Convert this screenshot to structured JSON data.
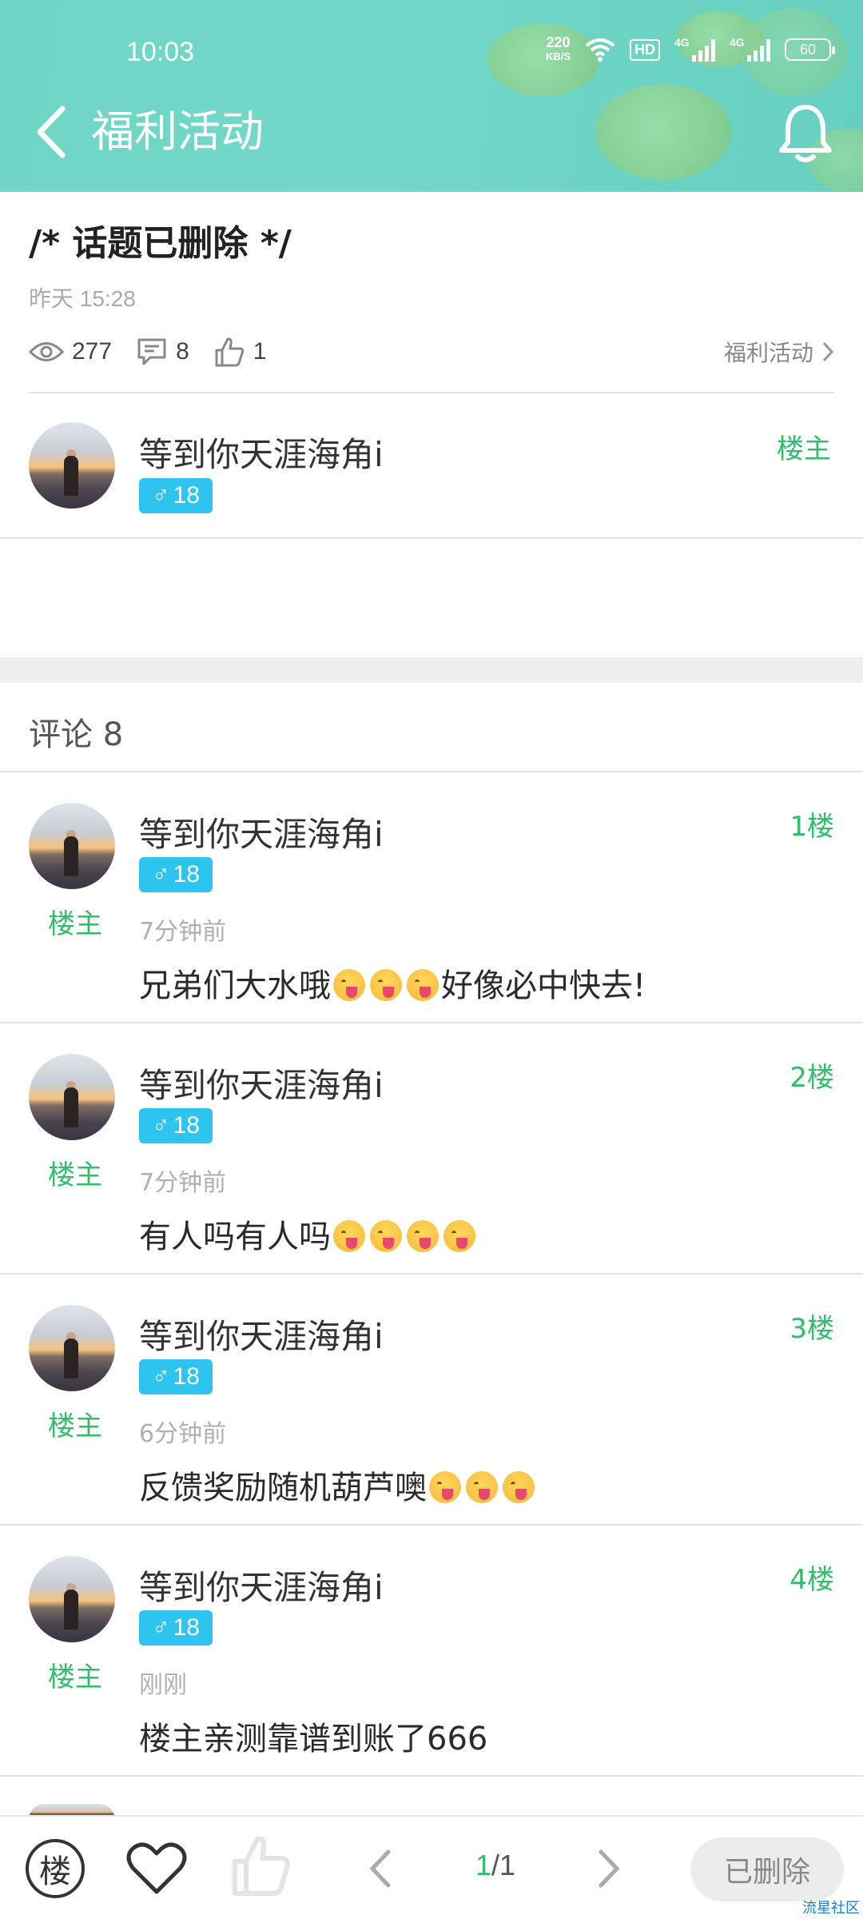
{
  "status_bar": {
    "time": "10:03",
    "net_speed_value": "220",
    "net_speed_unit": "KB/S",
    "hd_label": "HD",
    "signal_1": "4G",
    "signal_2": "4G",
    "battery": "60"
  },
  "header": {
    "title": "福利活动",
    "icons": [
      "back-arrow-icon",
      "bell-icon"
    ]
  },
  "topic": {
    "title": "/* 话题已删除 */",
    "time": "昨天 15:28",
    "views": "277",
    "comments": "8",
    "likes": "1",
    "category": "福利活动",
    "author": {
      "name": "等到你天涯海角i",
      "gender": "♂",
      "age": "18",
      "tag": "楼主"
    }
  },
  "comments_section": {
    "heading": "评论 8",
    "items": [
      {
        "name": "等到你天涯海角i",
        "gender": "♂",
        "age": "18",
        "owner_tag": "楼主",
        "floor": "1楼",
        "time": "7分钟前",
        "text_before": "兄弟们大水哦",
        "emoji_count": 3,
        "text_after": "好像必中快去!"
      },
      {
        "name": "等到你天涯海角i",
        "gender": "♂",
        "age": "18",
        "owner_tag": "楼主",
        "floor": "2楼",
        "time": "7分钟前",
        "text_before": "有人吗有人吗",
        "emoji_count": 4,
        "text_after": ""
      },
      {
        "name": "等到你天涯海角i",
        "gender": "♂",
        "age": "18",
        "owner_tag": "楼主",
        "floor": "3楼",
        "time": "6分钟前",
        "text_before": "反馈奖励随机葫芦噢",
        "emoji_count": 3,
        "text_after": ""
      },
      {
        "name": "等到你天涯海角i",
        "gender": "♂",
        "age": "18",
        "owner_tag": "楼主",
        "floor": "4楼",
        "time": "刚刚",
        "text_before": "楼主亲测靠谱到账了666",
        "emoji_count": 0,
        "text_after": ""
      }
    ]
  },
  "bottom_bar": {
    "floor_button": "楼",
    "page_current": "1",
    "page_total": "/1",
    "deleted_label": "已删除",
    "watermark": "流星社区"
  },
  "colors": {
    "header_bg": "#6fd6c6",
    "accent_green": "#2fbf6a",
    "gender_badge": "#2ec4f0"
  }
}
